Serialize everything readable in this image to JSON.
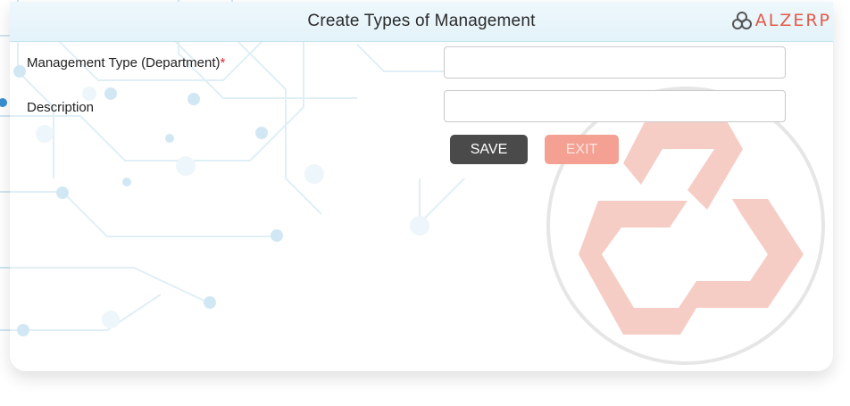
{
  "header": {
    "title": "Create Types of Management",
    "brand_logo": {
      "text": "ALZERP",
      "icon": "triad-circles-icon"
    }
  },
  "form": {
    "fields": [
      {
        "label": "Management Type (Department)",
        "required_mark": "*",
        "value": "",
        "placeholder": ""
      },
      {
        "label": "Description",
        "value": "",
        "placeholder": ""
      }
    ],
    "buttons": {
      "save_label": "SAVE",
      "exit_label": "EXIT"
    }
  },
  "watermark": {
    "icon": "alzerp-hexagon-knot-icon"
  },
  "colors": {
    "brand_accent": "#e25a47",
    "save_button": "#4a4a4a",
    "exit_button": "#f4a092",
    "required_star": "#e0292c",
    "header_bg": "#e6f4fa"
  }
}
